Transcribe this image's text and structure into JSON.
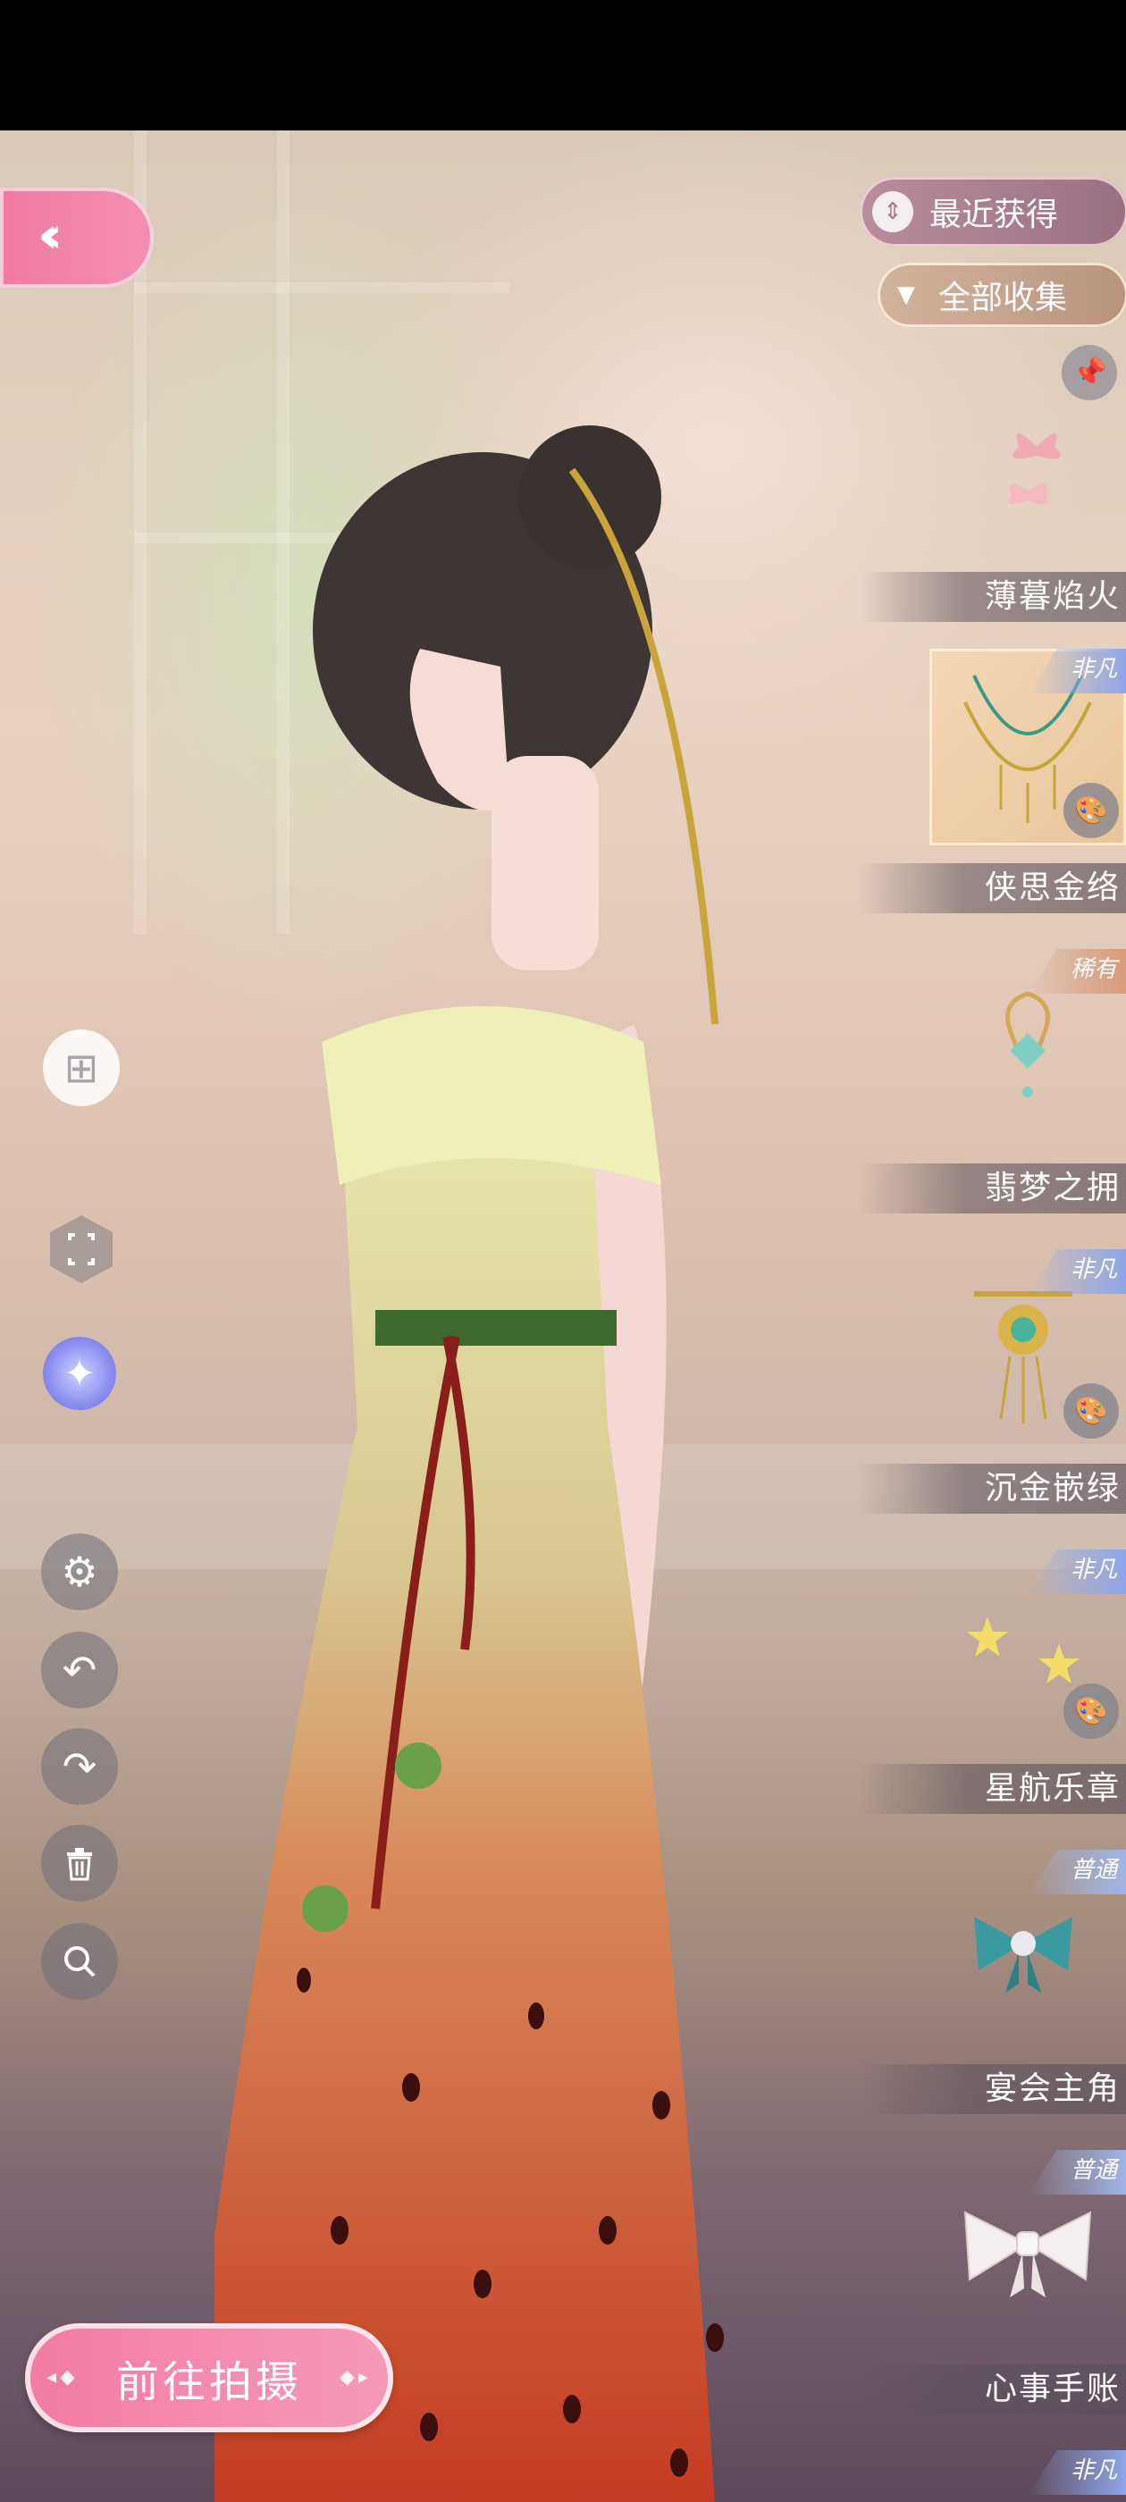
{
  "filters": {
    "recent_label": "最近获得",
    "all_label": "全部收集"
  },
  "left_controls": {
    "back_icon": "double-chevron-left-icon",
    "add_icon": "add-layer-icon",
    "fullscreen_icon": "fullscreen-icon",
    "magic_icon": "magic-wand-icon",
    "settings_icon": "gear-icon",
    "undo_icon": "undo-icon",
    "redo_icon": "redo-icon",
    "delete_icon": "trash-icon",
    "search_icon": "search-icon"
  },
  "shoot_button": {
    "label": "前往拍摄"
  },
  "items": [
    {
      "name": "薄暮焰火",
      "rarity": "",
      "has_palette": false,
      "icon": "butterfly-icon"
    },
    {
      "name": "侠思金络",
      "rarity": "非凡",
      "has_palette": true,
      "icon": "gold-necklace-icon",
      "selected": true
    },
    {
      "name": "翡梦之拥",
      "rarity": "稀有",
      "has_palette": false,
      "icon": "jade-earring-icon"
    },
    {
      "name": "沉金嵌绿",
      "rarity": "非凡",
      "has_palette": true,
      "icon": "gold-pendant-icon"
    },
    {
      "name": "星航乐章",
      "rarity": "非凡",
      "has_palette": true,
      "icon": "star-icon"
    },
    {
      "name": "宴会主角",
      "rarity": "普通",
      "has_palette": false,
      "icon": "teal-bow-icon"
    },
    {
      "name": "心事手账",
      "rarity": "普通",
      "has_palette": false,
      "icon": "white-bow-icon"
    },
    {
      "name": "",
      "rarity": "非凡",
      "has_palette": false,
      "icon": ""
    }
  ],
  "colors": {
    "accent_pink": "#f27ba2",
    "badge_feifan": "#8da6e8",
    "badge_xiyou": "#d79a7a"
  }
}
